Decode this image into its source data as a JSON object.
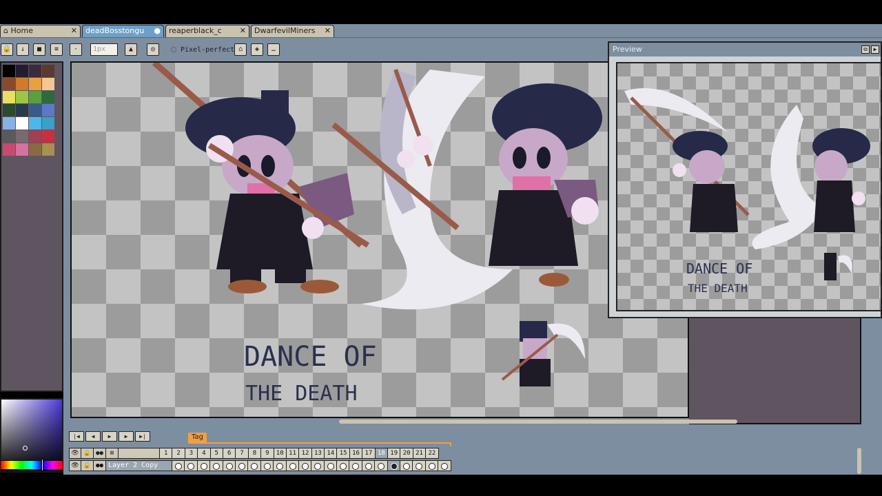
{
  "tabs": [
    {
      "label": "Home",
      "icon": "home-icon",
      "active": false
    },
    {
      "label": "deadBosstongu",
      "active": true,
      "modified": true
    },
    {
      "label": "reaperblack_c",
      "active": false
    },
    {
      "label": "DwarfevilMiners",
      "active": false
    }
  ],
  "toolbar": {
    "brush_size_placeholder": "1px",
    "pixel_perfect_label": "Pixel-perfect"
  },
  "preview": {
    "title": "Preview"
  },
  "canvas": {
    "artwork_text_line1": "DANCE OF",
    "artwork_text_line2": "THE DEATH"
  },
  "timeline": {
    "tag_label": "Tag",
    "layer_name": "Layer 2 Copy",
    "frames": [
      "1",
      "2",
      "3",
      "4",
      "5",
      "6",
      "7",
      "8",
      "9",
      "10",
      "11",
      "12",
      "13",
      "14",
      "15",
      "16",
      "17",
      "18",
      "19",
      "20",
      "21",
      "22"
    ],
    "current_frame": "18"
  },
  "palette": {
    "colors": [
      "#000000",
      "#221c2e",
      "#3c2a3e",
      "#5a3a30",
      "#8a4a2a",
      "#d07a2a",
      "#e8a040",
      "#f2c890",
      "#e8e060",
      "#9ac840",
      "#5aa040",
      "#2e6a3a",
      "#2c4a2e",
      "#2a3a4a",
      "#3a5a8a",
      "#5a7ac8",
      "#8ab0e8",
      "#ffffff",
      "#4ab8e8",
      "#3aa0c8",
      "#5a5a5a",
      "#7a6a70",
      "#a04050",
      "#c83040",
      "#c84a70",
      "#d870a0",
      "#8a6a40",
      "#a89050"
    ]
  }
}
